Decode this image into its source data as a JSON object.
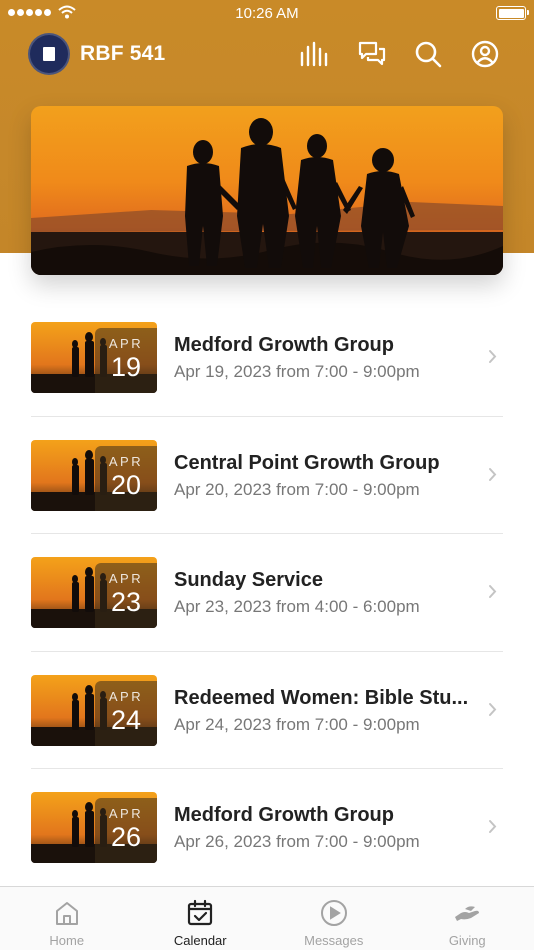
{
  "status_bar": {
    "time": "10:26 AM"
  },
  "app": {
    "title": "RBF 541"
  },
  "top_icons": [
    "bars-chart-icon",
    "chat-bubbles-icon",
    "search-icon",
    "profile-icon"
  ],
  "events": [
    {
      "month": "APR",
      "day": "19",
      "title": "Medford Growth Group",
      "time": "Apr 19, 2023 from 7:00 - 9:00pm"
    },
    {
      "month": "APR",
      "day": "20",
      "title": "Central Point Growth Group",
      "time": "Apr 20, 2023 from 7:00 - 9:00pm"
    },
    {
      "month": "APR",
      "day": "23",
      "title": "Sunday Service",
      "time": "Apr 23, 2023 from 4:00 - 6:00pm"
    },
    {
      "month": "APR",
      "day": "24",
      "title": "Redeemed Women: Bible Stu...",
      "time": "Apr 24, 2023 from 7:00 - 9:00pm"
    },
    {
      "month": "APR",
      "day": "26",
      "title": "Medford Growth Group",
      "time": "Apr 26, 2023 from 7:00 - 9:00pm"
    }
  ],
  "tabs": [
    {
      "label": "Home",
      "icon": "home-icon",
      "active": false
    },
    {
      "label": "Calendar",
      "icon": "calendar-icon",
      "active": true
    },
    {
      "label": "Messages",
      "icon": "play-icon",
      "active": false
    },
    {
      "label": "Giving",
      "icon": "giving-hand-icon",
      "active": false
    }
  ],
  "colors": {
    "header": "#c98a28",
    "text_primary": "#222222",
    "text_secondary": "#777777",
    "tab_inactive": "#a3a3a3"
  }
}
